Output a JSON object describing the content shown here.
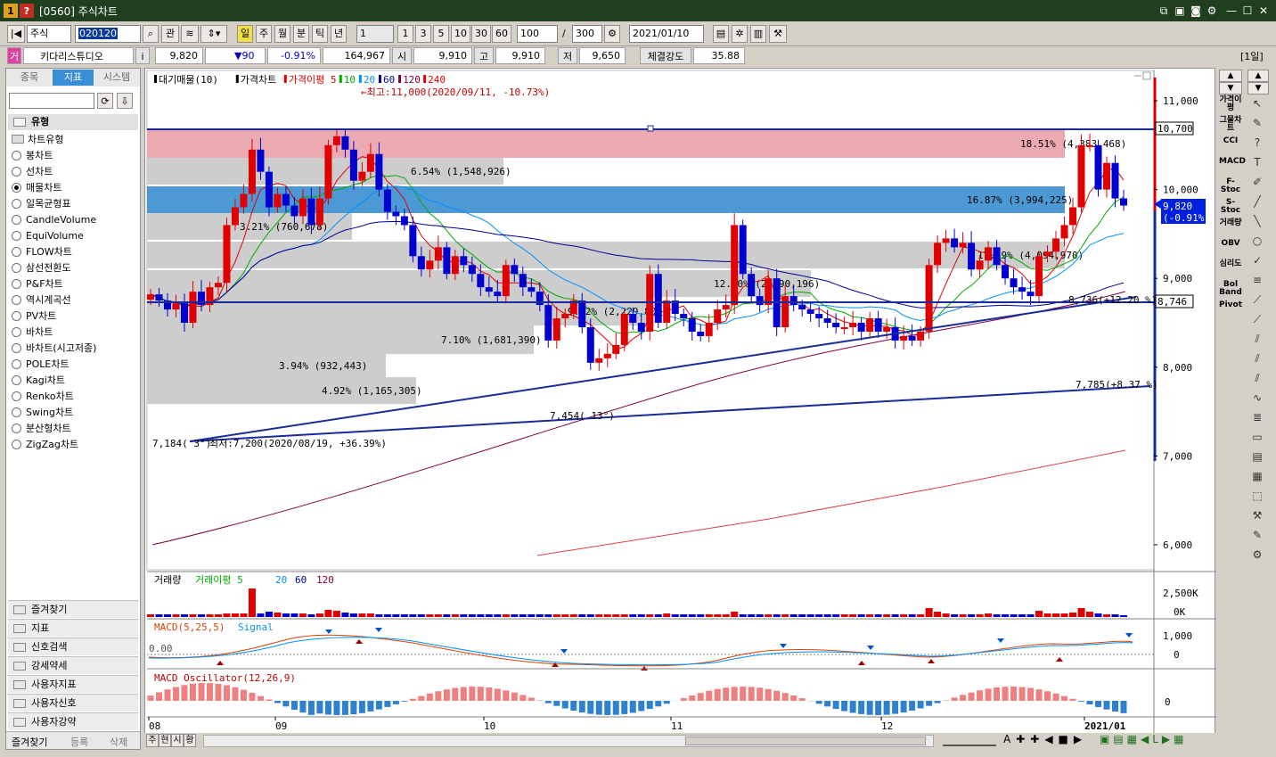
{
  "window": {
    "title": "[0560] 주식차트",
    "badge1": "1",
    "badge2": "?"
  },
  "toolbar": {
    "market": "주식",
    "code": "020120",
    "gwan": "관",
    "periods": [
      "일",
      "주",
      "월",
      "분",
      "틱",
      "년"
    ],
    "interval": "1",
    "quick": [
      "1",
      "3",
      "5",
      "10",
      "30",
      "60"
    ],
    "count": "100",
    "slash": "/",
    "total": "300",
    "date": "2021/01/10"
  },
  "info": {
    "tag": "거",
    "name": "키다리스튜디오",
    "i": "i",
    "price": "9,820",
    "change": "▼90",
    "rate": "-0.91%",
    "volume": "164,967",
    "open_lbl": "시",
    "open": "9,910",
    "high_lbl": "고",
    "high": "9,910",
    "low_lbl": "저",
    "low": "9,650",
    "str_lbl": "체결강도",
    "strength": "35.88",
    "period_tag": "[1일]"
  },
  "sidebar": {
    "tabs": [
      "종목",
      "지표",
      "시스템"
    ],
    "header": "유형",
    "group": "차트유형",
    "items": [
      "봉차트",
      "선차트",
      "매물차트",
      "일목균형표",
      "CandleVolume",
      "EquiVolume",
      "FLOW차트",
      "삼선전환도",
      "P&F차트",
      "역시계곡선",
      "PV차트",
      "바차트",
      "바차트(시고저종)",
      "POLE차트",
      "Kagi차트",
      "Renko차트",
      "Swing차트",
      "분산형차트",
      "ZigZag차트"
    ],
    "selected": 2,
    "folders": [
      "즐겨찾기",
      "지표",
      "신호검색",
      "강세약세",
      "사용자지표",
      "사용자신호",
      "사용자강약"
    ],
    "bottom": [
      "즐겨찾기",
      "등록",
      "삭제"
    ]
  },
  "chart": {
    "legend": [
      "대기매물(10)",
      "가격차트",
      "가격이평 5",
      "10",
      "20",
      "60",
      "120",
      "240"
    ],
    "legend_colors": [
      "#000000",
      "#000000",
      "#e00000",
      "#00aa00",
      "#0090ff",
      "#000090",
      "#800040",
      "#e00000"
    ],
    "yticks": [
      "11,000",
      "10,000",
      "9,000",
      "8,000",
      "7,000",
      "6,000"
    ],
    "xticks": [
      "08",
      "09",
      "10",
      "11",
      "12",
      "2021/01"
    ],
    "price_tag": "9,820",
    "price_tag2": "(-0.91%)",
    "line_tag1": "10,700",
    "line_tag2": "8,746",
    "annotations": {
      "high": "←최고:11,000(2020/09/11, -10.73%)",
      "low": "최저:7,200(2020/08/19, +36.39%)",
      "l1": "7,184( 3°)",
      "l2": "7,454( 13°)",
      "l3": "8,736(+12.20 %)",
      "l4": "7,785(+8.37 %)"
    },
    "vol_profile": [
      {
        "label": "18.51% (4,383,468)"
      },
      {
        "label": "16.87% (3,994,225)"
      },
      {
        "label": "6.54% (1,548,926)"
      },
      {
        "label": "3.21% (760,678)"
      },
      {
        "label": "17.29% (4,094,970)"
      },
      {
        "label": "12.40% (2,890,196)"
      },
      {
        "label": "9.42% (2,229,805)"
      },
      {
        "label": "7.10% (1,681,390)"
      },
      {
        "label": "3.94% (932,443)"
      },
      {
        "label": "4.92% (1,165,305)"
      }
    ],
    "volume_legend": [
      "거래량",
      "거래이평 5",
      "20",
      "60",
      "120"
    ],
    "vol_ticks": [
      "2,500K",
      "0K"
    ],
    "macd_legend": [
      "MACD(5,25,5)",
      "Signal"
    ],
    "macd_ticks": [
      "1,000",
      "0"
    ],
    "macd_zero": "0.00",
    "osc_legend": "MACD Oscillator(12,26,9)",
    "osc_tick": "0"
  },
  "rightbar": {
    "labels": [
      "가격이평",
      "그물차트",
      "CCI",
      "MACD",
      "F-Stoc",
      "S-Stoc",
      "거래량",
      "OBV",
      "심리도",
      "Bol Band",
      "Pivot"
    ]
  },
  "bottom": {
    "tabs": [
      "주",
      "현",
      "시",
      "황"
    ]
  }
}
